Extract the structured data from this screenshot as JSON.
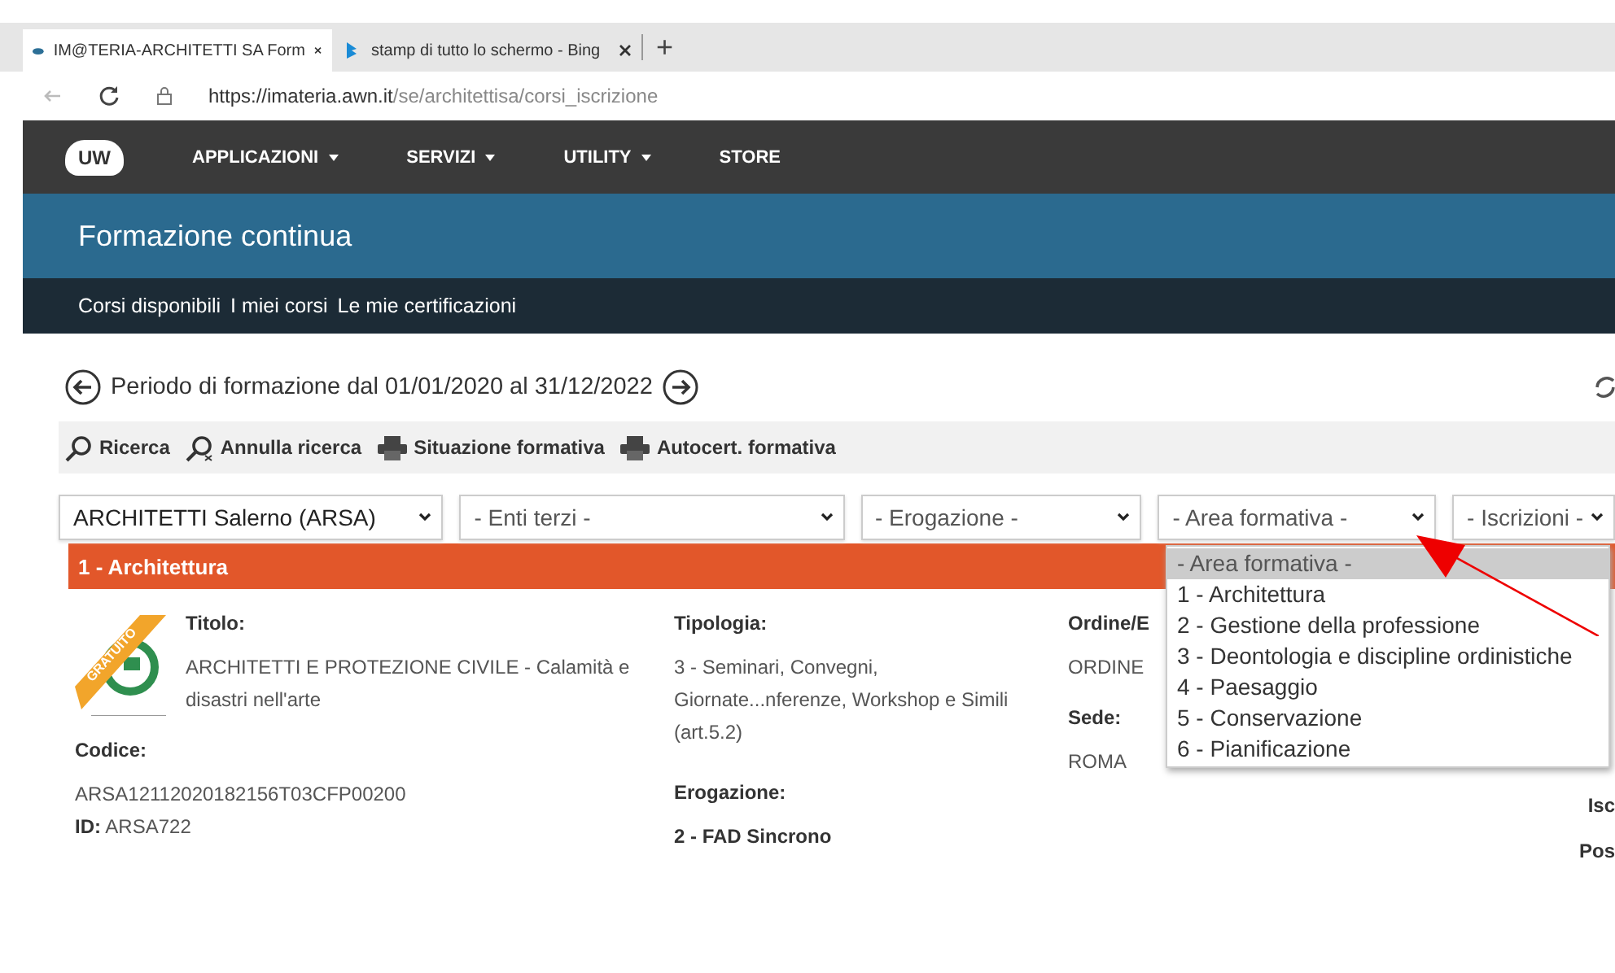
{
  "browser": {
    "tabs": [
      {
        "label": "IM@TERIA-ARCHITETTI SA Form",
        "selected": true
      },
      {
        "label": "stamp di tutto lo schermo - Bing",
        "selected": false
      }
    ],
    "new_tab": "+",
    "url_host": "https://imateria.awn.it",
    "url_path": "/se/architettisa/corsi_iscrizione"
  },
  "nav": {
    "logo": "UW",
    "items": [
      {
        "label": "APPLICAZIONI",
        "has_menu": true
      },
      {
        "label": "SERVIZI",
        "has_menu": true
      },
      {
        "label": "UTILITY",
        "has_menu": true
      },
      {
        "label": "STORE",
        "has_menu": false
      }
    ]
  },
  "header": {
    "title": "Formazione continua"
  },
  "subnav": [
    "Corsi disponibili",
    "I miei corsi",
    "Le mie certificazioni"
  ],
  "period": "Periodo di formazione dal 01/01/2020 al 31/12/2022",
  "toolbar": [
    {
      "kind": "search",
      "label": "Ricerca"
    },
    {
      "kind": "clear",
      "label": "Annulla ricerca"
    },
    {
      "kind": "print",
      "label": "Situazione formativa"
    },
    {
      "kind": "print",
      "label": "Autocert. formativa"
    }
  ],
  "filters": [
    {
      "value": "ARCHITETTI Salerno (ARSA)",
      "placeholder": false
    },
    {
      "value": "- Enti terzi -",
      "placeholder": true
    },
    {
      "value": "- Erogazione -",
      "placeholder": true
    },
    {
      "value": "- Area formativa -",
      "placeholder": true,
      "expanded": true
    },
    {
      "value": "- Iscrizioni -",
      "placeholder": true
    }
  ],
  "dropdown": [
    {
      "label": "- Area formativa -",
      "selected": true
    },
    {
      "label": "1 - Architettura",
      "selected": false
    },
    {
      "label": "2 - Gestione della professione",
      "selected": false
    },
    {
      "label": "3 - Deontologia e discipline ordinistiche",
      "selected": false
    },
    {
      "label": "4 - Paesaggio",
      "selected": false
    },
    {
      "label": "5 - Conservazione",
      "selected": false
    },
    {
      "label": "6 - Pianificazione",
      "selected": false
    }
  ],
  "group": {
    "title": "1 - Architettura"
  },
  "record": {
    "badge": "GRATUITO",
    "title_label": "Titolo:",
    "title": "ARCHITETTI E PROTEZIONE CIVILE - Calamità e disastri nell'arte",
    "code_label": "Codice:",
    "code": "ARSA12112020182156T03CFP00200",
    "id_label": "ID:",
    "id": "ARSA722",
    "type_label": "Tipologia:",
    "type": "3 - Seminari, Convegni, Giornate...nferenze, Workshop e Simili (art.5.2)",
    "delivery_label": "Erogazione:",
    "delivery": "2 - FAD Sincrono",
    "order_label": "Ordine/E",
    "order": "ORDINE",
    "place_label": "Sede:",
    "place": "ROMA",
    "column_4": [
      "Isc",
      "Pos"
    ]
  }
}
